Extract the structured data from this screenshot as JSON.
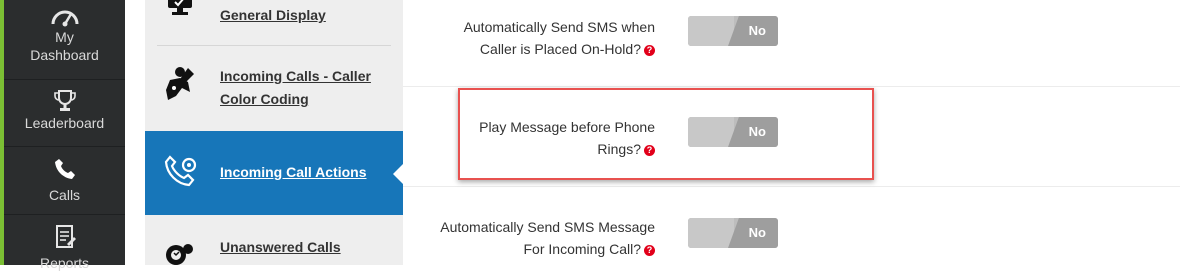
{
  "left_nav": {
    "items": [
      {
        "label_line1": "My",
        "label_line2": "Dashboard",
        "icon": "gauge-icon"
      },
      {
        "label": "Leaderboard",
        "icon": "trophy-icon"
      },
      {
        "label": "Calls",
        "icon": "phone-icon"
      },
      {
        "label": "Reports",
        "icon": "report-icon"
      }
    ],
    "accent_color": "#7bbf34"
  },
  "settings_menu": {
    "items": [
      {
        "label": "General Display",
        "icon": "monitor-icon"
      },
      {
        "label_line1": "Incoming Calls - Caller",
        "label_line2": "Color Coding",
        "icon": "palette-person-icon"
      },
      {
        "label": "Incoming Call Actions",
        "icon": "phone-gear-icon",
        "active": true
      },
      {
        "label": "Unanswered Calls",
        "icon": "gear-phone-icon"
      }
    ],
    "active_color": "#1776b9"
  },
  "settings": [
    {
      "label_line1": "Automatically Send SMS when",
      "label_line2": "Caller is Placed On-Hold?",
      "help": "?",
      "toggle": "No"
    },
    {
      "label_line1": "Play Message before Phone",
      "label_line2": "Rings?",
      "help": "?",
      "toggle": "No",
      "highlighted": true
    },
    {
      "label_line1": "Automatically Send SMS Message",
      "label_line2": "For Incoming Call?",
      "help": "?",
      "toggle": "No"
    }
  ],
  "colors": {
    "highlight": "#e8514f",
    "help_icon": "#e2001a"
  }
}
